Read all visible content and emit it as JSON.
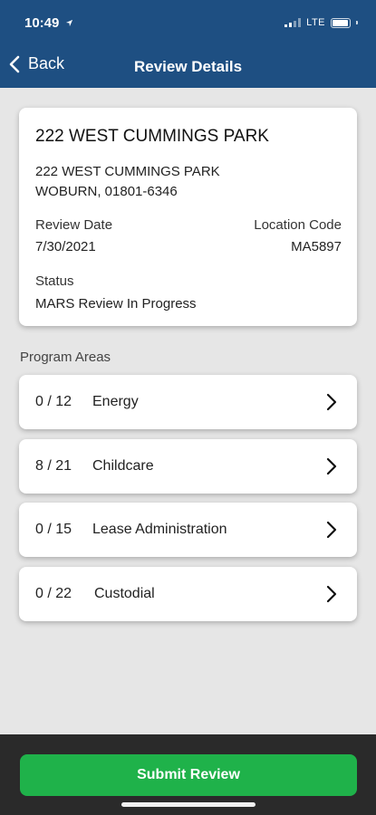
{
  "status_bar": {
    "time": "10:49",
    "network": "LTE"
  },
  "nav": {
    "back_label": "Back",
    "title": "Review Details"
  },
  "details": {
    "name": "222 WEST CUMMINGS PARK",
    "address_line1": "222 WEST CUMMINGS PARK",
    "address_line2": "WOBURN,  01801-6346",
    "review_date_label": "Review Date",
    "review_date": "7/30/2021",
    "location_code_label": "Location Code",
    "location_code": "MA5897",
    "status_label": "Status",
    "status": "MARS Review In Progress"
  },
  "program_areas": {
    "label": "Program Areas",
    "items": [
      {
        "count": "0 / 12",
        "name": "Energy"
      },
      {
        "count": "8 / 21",
        "name": "Childcare"
      },
      {
        "count": "0 / 15",
        "name": "Lease Administration"
      },
      {
        "count": "0 / 22",
        "name": "Custodial"
      }
    ]
  },
  "footer": {
    "submit_label": "Submit Review"
  },
  "colors": {
    "header": "#1e4f82",
    "submit": "#1fb24a",
    "footer": "#2a2a2a",
    "background": "#e6e6e6"
  },
  "icons": {
    "back": "chevron-left-icon",
    "row": "chevron-right-icon",
    "location": "location-arrow-icon"
  }
}
